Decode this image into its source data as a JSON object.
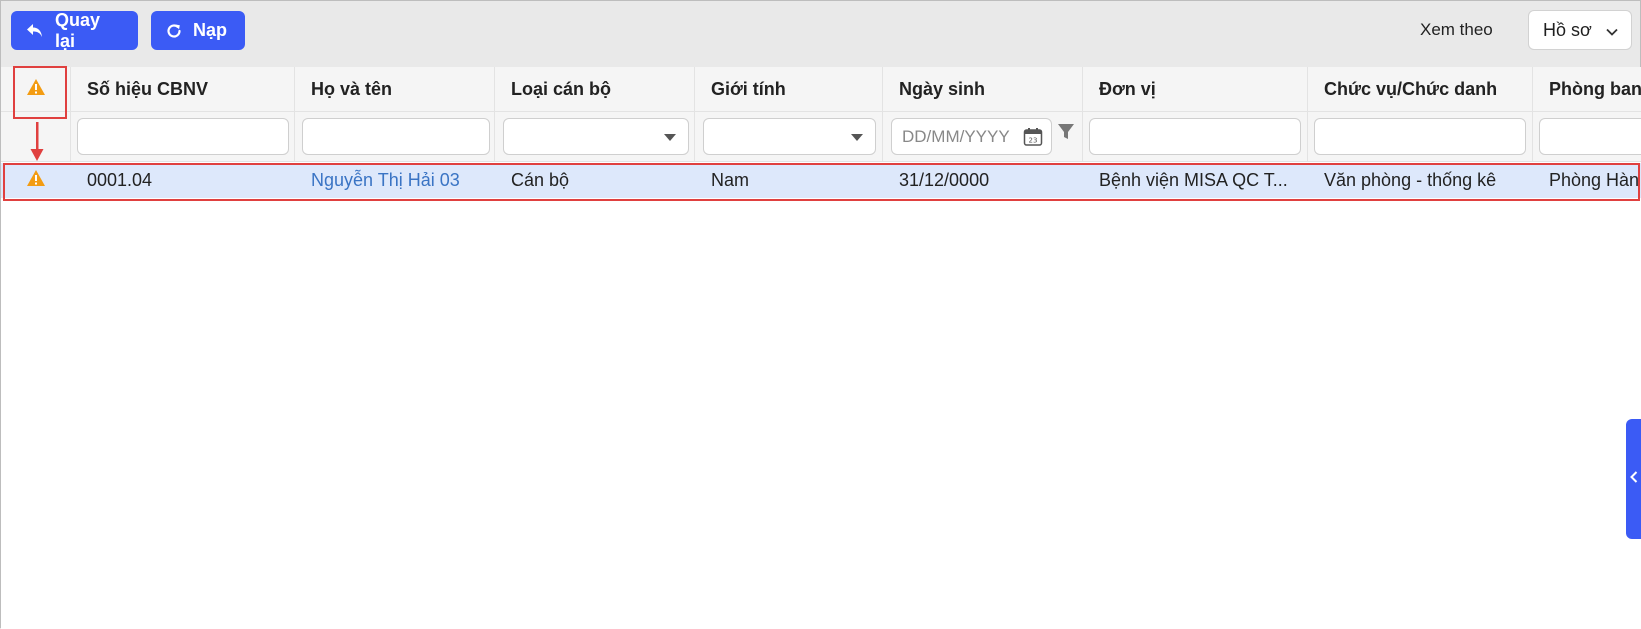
{
  "toolbar": {
    "back_label": "Quay lại",
    "reload_label": "Nạp",
    "view_label": "Xem theo",
    "view_value": "Hồ sơ"
  },
  "columns": [
    "Số hiệu CBNV",
    "Họ và tên",
    "Loại cán bộ",
    "Giới tính",
    "Ngày sinh",
    "Đơn vị",
    "Chức vụ/Chức danh",
    "Phòng ban"
  ],
  "filters": {
    "date_placeholder": "DD/MM/YYYY",
    "calendar_day": "23"
  },
  "rows": [
    {
      "employee_id": "0001.04",
      "full_name": "Nguyễn Thị Hải 03",
      "staff_type": "Cán bộ",
      "gender": "Nam",
      "birth_date": "31/12/0000",
      "unit": "Bệnh viện MISA QC T...",
      "position": "Văn phòng - thống kê",
      "department": "Phòng Hàn"
    }
  ],
  "colors": {
    "primary": "#3b5bf5",
    "warning": "#f39c12",
    "highlight": "#e0403f",
    "selected_row": "#dde8fb",
    "link": "#3a74c4"
  },
  "icons": {
    "back": "undo-arrow-icon",
    "reload": "refresh-icon",
    "warning": "warning-triangle-icon",
    "calendar": "calendar-icon",
    "filter": "funnel-icon",
    "chevron": "chevron-down-icon",
    "side": "chevron-left-icon"
  }
}
